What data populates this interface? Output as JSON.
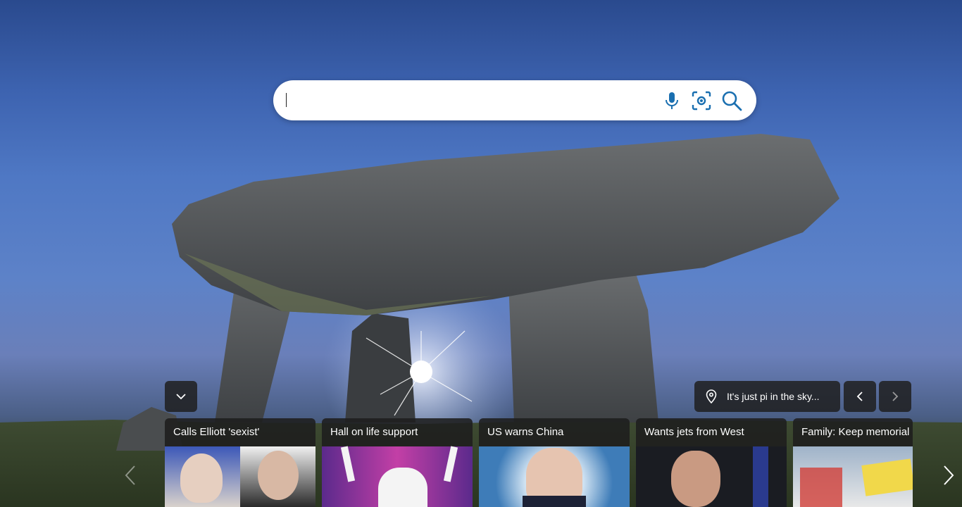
{
  "search": {
    "value": "",
    "placeholder": ""
  },
  "icons": {
    "mic": "microphone-icon",
    "visual": "visual-search-icon",
    "search": "search-icon",
    "location": "location-pin-icon",
    "collapse": "chevron-down-icon",
    "prev": "chevron-left-icon",
    "next": "chevron-right-icon"
  },
  "colors": {
    "accent": "#1a6fb0",
    "panel": "#1e1e1e"
  },
  "image_info": {
    "title": "It's just pi in the sky..."
  },
  "news": [
    {
      "title": "Calls Elliott 'sexist'"
    },
    {
      "title": "Hall on life support"
    },
    {
      "title": "US warns China"
    },
    {
      "title": "Wants jets from West"
    },
    {
      "title": "Family: Keep memorial"
    }
  ]
}
